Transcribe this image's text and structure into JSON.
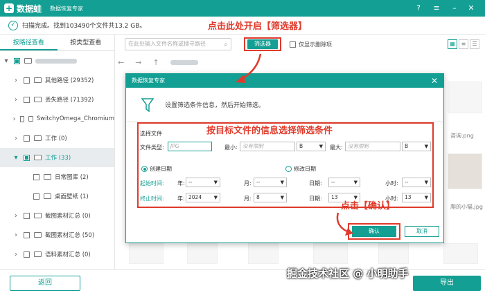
{
  "app": {
    "name": "数据蛙",
    "subtitle": "数据恢复专家",
    "logo_glyph": "+",
    "brand_color": "#139f93",
    "accent_red": "#e03a2b"
  },
  "status": {
    "text": "扫描完成。找到103490个文件共13.2 GB。"
  },
  "annotations": {
    "top": "点击此处开启【筛选器】",
    "middle": "按目标文件的信息选择筛选条件",
    "bottom": "点击【确认】"
  },
  "sidebar": {
    "tabs": [
      "按路径查看",
      "按类型查看"
    ],
    "items": [
      {
        "label": "其他路径 (29352)"
      },
      {
        "label": "丢失路径 (71392)"
      },
      {
        "label": "SwitchyOmega_Chromium"
      },
      {
        "label": "工作 (0)"
      },
      {
        "label": "工作 (33)"
      },
      {
        "label": "日常图库 (2)"
      },
      {
        "label": "桌面壁纸 (1)"
      },
      {
        "label": "截图素材汇总 (0)"
      },
      {
        "label": "截图素材汇总 (50)"
      },
      {
        "label": "语料素材汇总 (0)"
      }
    ]
  },
  "toolbar": {
    "search_placeholder": "在此处输入文件名称或搜寻路径",
    "filter_label": "筛选器",
    "only_deleted_label": "仅显示删除项"
  },
  "background": {
    "file1": "咨询.png",
    "file2": "爬的小猫.jpg"
  },
  "dialog": {
    "title": "数据恢复专家",
    "info": "设置筛选条件信息，然后开始筛选。",
    "select_file_label": "选择文件",
    "file_type_label": "文件类型:",
    "file_type_placeholder": "JPG",
    "min_label": "最小:",
    "min_placeholder": "没有限制",
    "min_unit": "B",
    "max_label": "最大:",
    "max_placeholder": "没有限制",
    "max_unit": "B",
    "created_label": "创建日期",
    "modified_label": "修改日期",
    "start_label": "起始时间:",
    "end_label": "终止时间:",
    "year_label": "年:",
    "month_label": "月:",
    "day_label": "日期:",
    "hour_label": "小时:",
    "start": {
      "year": "--",
      "month": "--",
      "day": "--",
      "hour": "--"
    },
    "end": {
      "year": "2024",
      "month": "8",
      "day": "13",
      "hour": "13"
    },
    "ok_label": "确认",
    "cancel_label": "取消"
  },
  "footer": {
    "back_label": "返回",
    "export_label": "导出",
    "watermark": "掘金技术社区 @ 小明助手"
  }
}
